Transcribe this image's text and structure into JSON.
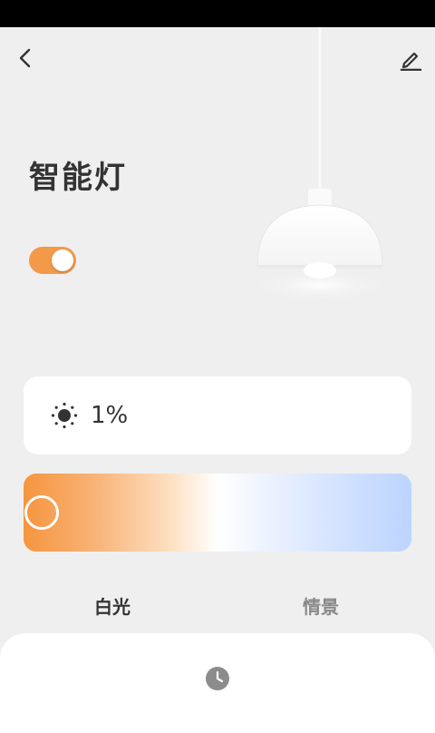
{
  "device": {
    "title": "智能灯",
    "power_on": true
  },
  "brightness": {
    "value_text": "1%",
    "icon": "sun-icon"
  },
  "color_temperature": {
    "level": 0.0,
    "colors": {
      "warm": "#f6953f",
      "neutral": "#ffffff",
      "cool": "#bcd4ff"
    }
  },
  "tabs": [
    {
      "label": "白光",
      "active": true
    },
    {
      "label": "情景",
      "active": false
    }
  ],
  "icons": {
    "back": "back-icon",
    "edit": "edit-icon",
    "clock": "clock-icon"
  },
  "colors": {
    "accent": "#f39a4a",
    "background": "#efefef"
  }
}
